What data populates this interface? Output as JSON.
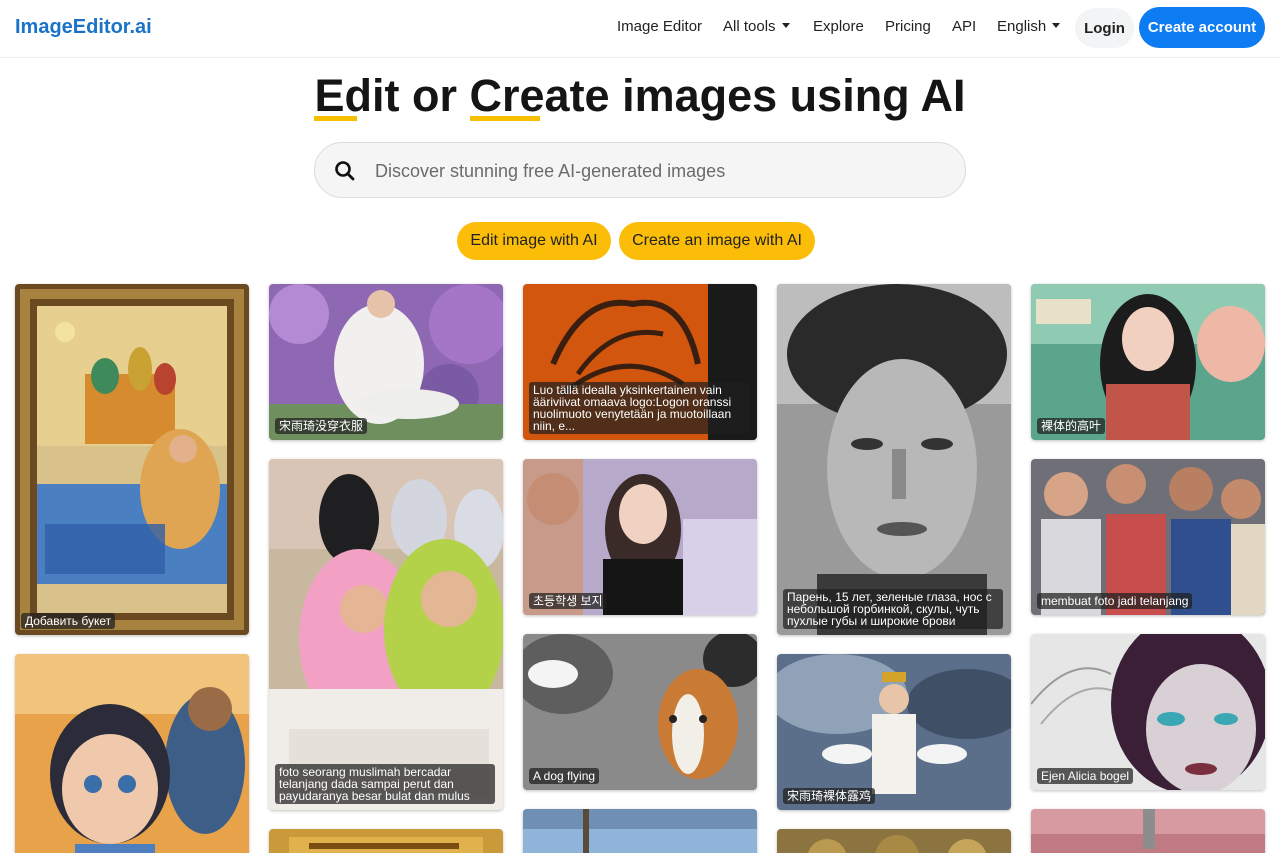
{
  "brand": "ImageEditor.ai",
  "nav": {
    "image_editor": "Image Editor",
    "all_tools": "All tools",
    "explore": "Explore",
    "pricing": "Pricing",
    "api": "API",
    "language": "English",
    "login": "Login",
    "create_account": "Create account"
  },
  "hero": {
    "word1": "Edit",
    "word2": "or",
    "word3": "Create",
    "rest": "images using AI"
  },
  "search": {
    "placeholder": "Discover stunning free AI-generated images"
  },
  "buttons": {
    "edit_with_ai": "Edit image with AI",
    "create_with_ai": "Create an image with AI"
  },
  "gallery": [
    {
      "caption": "Добавить букет"
    },
    {
      "caption": ""
    },
    {
      "caption": "宋雨琦没穿衣服"
    },
    {
      "caption": "foto seorang muslimah bercadar telanjang dada sampai perut dan payudaranya besar bulat dan mulus"
    },
    {
      "caption": ""
    },
    {
      "caption": "Luo tällä idealla yksinkertainen vain ääriviivat omaava logo:Logon oranssi nuolimuoto venytetään ja muotoillaan niin, e..."
    },
    {
      "caption": "초등학생 보지"
    },
    {
      "caption": "A dog flying"
    },
    {
      "caption": ""
    },
    {
      "caption": "Парень, 15 лет, зеленые глаза, нос с небольшой горбинкой, скулы, чуть пухлые губы и широкие брови"
    },
    {
      "caption": "宋雨琦裸体露鸡"
    },
    {
      "caption": ""
    },
    {
      "caption": "裸体的高叶"
    },
    {
      "caption": "membuat foto jadi telanjang"
    },
    {
      "caption": "Ejen Alicia bogel"
    },
    {
      "caption": ""
    }
  ],
  "colors": {
    "brand": "#1a73c9",
    "primary": "#0d7bf2",
    "accent": "#fbbd08"
  }
}
